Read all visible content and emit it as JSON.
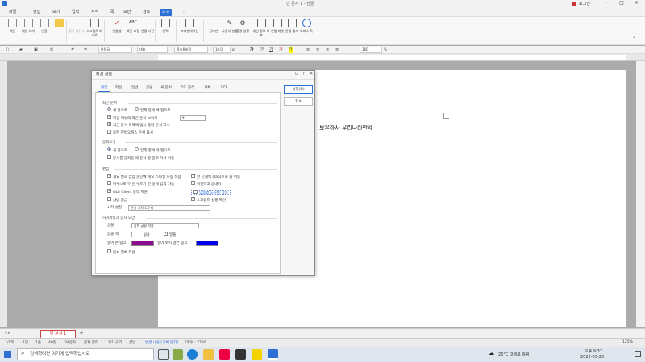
{
  "window": {
    "title": "빈 문서 1 - 한글",
    "login": "로그인",
    "controls": [
      "─",
      "□",
      "✕"
    ]
  },
  "menubar": {
    "items": [
      "파일",
      "편집",
      "보기",
      "입력",
      "서식",
      "쪽",
      "보안",
      "검토",
      "도구"
    ],
    "active_index": 8
  },
  "ribbon": {
    "buttons": [
      {
        "label": "색인",
        "icon": "index-icon"
      },
      {
        "label": "메일 머지",
        "icon": "mail-merge-icon"
      },
      {
        "label": "인용",
        "icon": "citation-icon"
      },
      {
        "label": "",
        "icon": "format-icon"
      },
      {
        "label": "블록 계산식",
        "icon": "block-calc-icon"
      },
      {
        "label": "스크립트 매크로",
        "icon": "macro-icon"
      },
      {
        "label": "맞춤법",
        "icon": "spellcheck-icon"
      },
      {
        "label": "빠른 교정",
        "icon": "quick-correct-icon"
      },
      {
        "label": "한컴 사전",
        "icon": "dictionary-icon"
      },
      {
        "label": "번역",
        "icon": "translate-icon"
      },
      {
        "label": "프레젠테이션",
        "icon": "presentation-icon"
      },
      {
        "label": "글자판",
        "icon": "keyboard-icon"
      },
      {
        "label": "사용자 설정",
        "icon": "user-setting-icon"
      },
      {
        "label": "환경 설정",
        "icon": "preferences-icon"
      },
      {
        "label": "개인 정보 보호",
        "icon": "privacy-icon"
      },
      {
        "label": "한컴 애셋",
        "icon": "asset-icon"
      },
      {
        "label": "한컴 툴즈",
        "icon": "tools-icon"
      },
      {
        "label": "오피스 톡",
        "icon": "office-talk-icon"
      }
    ]
  },
  "formatbar": {
    "style": "바탕글",
    "lang": "대표",
    "font": "함초롬바탕",
    "size": "10.0",
    "unit": "pt",
    "zoom": "160",
    "zoom_unit": "%",
    "format_buttons": [
      "가",
      "가",
      "가",
      "가",
      "가"
    ]
  },
  "document": {
    "text": "보우하사 우리나라만세"
  },
  "dialog": {
    "title": "환경 설정",
    "title_controls": [
      "⊡",
      "?",
      "✕"
    ],
    "tabs": [
      "편집",
      "파일",
      "일반",
      "글꼴",
      "새 문서",
      "코드 형식",
      "개체",
      "기타"
    ],
    "active_tab": 0,
    "ok_button": "설정(D)",
    "cancel_button": "취소",
    "recent_doc": {
      "label": "최근 문서",
      "opt_new_tab": "새 창으로",
      "opt_current": "현재 창에 새 탭으로",
      "show_count_label": "파일 메뉴에 최근 문서 보이기",
      "show_count_value": "9",
      "list_temp": "최근 문서 목록에 임시 폴더 문서 표시",
      "show_hancom_office": "모든 한컴오피스 문서 표시"
    },
    "file_open": {
      "label": "불러오기",
      "opt_new_tab": "새 창으로",
      "opt_current": "현재 창에 새 탭으로",
      "cursor_move": "문서를 불러올 때 문서 끝 줄로 커서 이동"
    },
    "edit": {
      "label": "편집",
      "auto_list": "개요 번호 삽입 문단에 개요 스타일 자동 적용",
      "tab_indent": "한 단계씩 (Tab)으로 줄 이동",
      "mouse_click": "마우스로 두 번 누르기 한 곳에 입력 가능",
      "confirm_close": "확인하고 끝내기",
      "ole_client": "OLE Client 동작 지원",
      "show_guideline": "맞춤법 도우미 작동",
      "insert_quick": "삽입 잠금",
      "script_run": "스크립트 실행 확인",
      "view_setting_label": "시작 설정",
      "view_setting_value": "문서 시작 도우미"
    },
    "hyperlink": {
      "label": "하이퍼링크 글자 모양",
      "style_label": "글꼴",
      "style_value": "함께 글꼴 적용",
      "underline_label": "글꼴 색",
      "underline_value": "밑줄",
      "check_underline": "밑줄",
      "visited_label": "열어 본 링크",
      "unvisited_label": "열어 보지 않은 링크",
      "visited_color": "#8b0d8b",
      "unvisited_color": "#0000ee",
      "apply_all": "문서 전체 적용"
    }
  },
  "tabstrip": {
    "doc_tab": "빈 문서 1",
    "add": "+"
  },
  "statusbar": {
    "items": [
      "1/1쪽",
      "1단",
      "1줄",
      "40칸",
      "34글자",
      "문자 입력",
      "1/1 구역",
      "삽입"
    ],
    "track": "변경 내용 [기록 중지]",
    "info": "미/수 : 2730",
    "zoom": "125%"
  },
  "taskbar": {
    "search_placeholder": "검색하려면 여기에 입력하십시오",
    "weather": "26°C 대체로 흐림",
    "time": "오후 9:37",
    "date": "2022-05-23"
  }
}
